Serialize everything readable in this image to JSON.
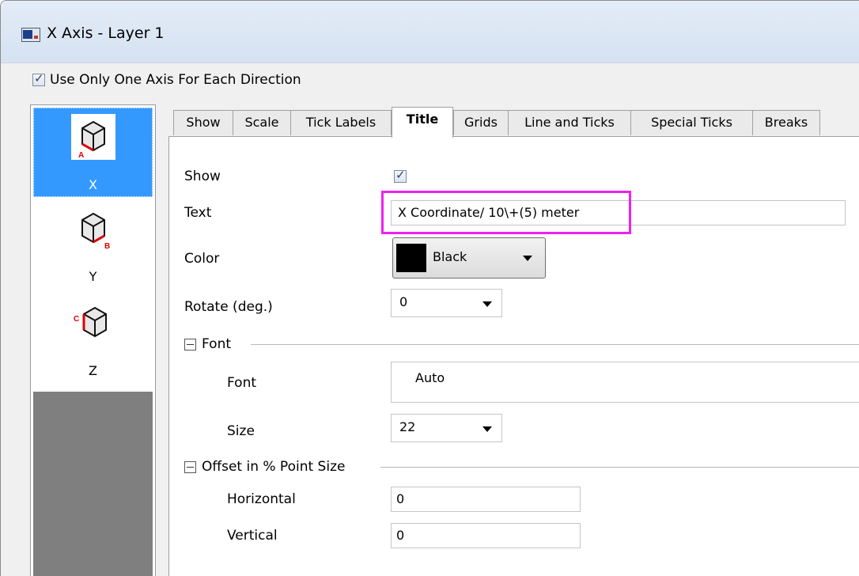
{
  "window": {
    "title": "X Axis - Layer 1"
  },
  "use_one_axis": {
    "label": "Use Only One Axis For Each Direction",
    "checked": true
  },
  "sidebar": {
    "items": [
      {
        "label": "X",
        "letter": "A",
        "selected": true
      },
      {
        "label": "Y",
        "letter": "B",
        "selected": false
      },
      {
        "label": "Z",
        "letter": "C",
        "selected": false
      }
    ]
  },
  "tabs": [
    "Show",
    "Scale",
    "Tick Labels",
    "Title",
    "Grids",
    "Line and Ticks",
    "Special Ticks",
    "Breaks"
  ],
  "active_tab": "Title",
  "form": {
    "show_label": "Show",
    "show_checked": true,
    "text_label": "Text",
    "text_value": "X Coordinate/ 10\\+(5) meter",
    "color_label": "Color",
    "color_value": "Black",
    "color_hex": "#000000",
    "rotate_label": "Rotate (deg.)",
    "rotate_value": "0",
    "font_group": "Font",
    "font_label": "Font",
    "font_value": "Auto",
    "size_label": "Size",
    "size_value": "22",
    "offset_group": "Offset in % Point Size",
    "horizontal_label": "Horizontal",
    "horizontal_value": "0",
    "vertical_label": "Vertical",
    "vertical_value": "0"
  },
  "colors": {
    "selection": "#3399ff",
    "highlight": "#ee22ee",
    "axis_letter": "#dd0000"
  }
}
